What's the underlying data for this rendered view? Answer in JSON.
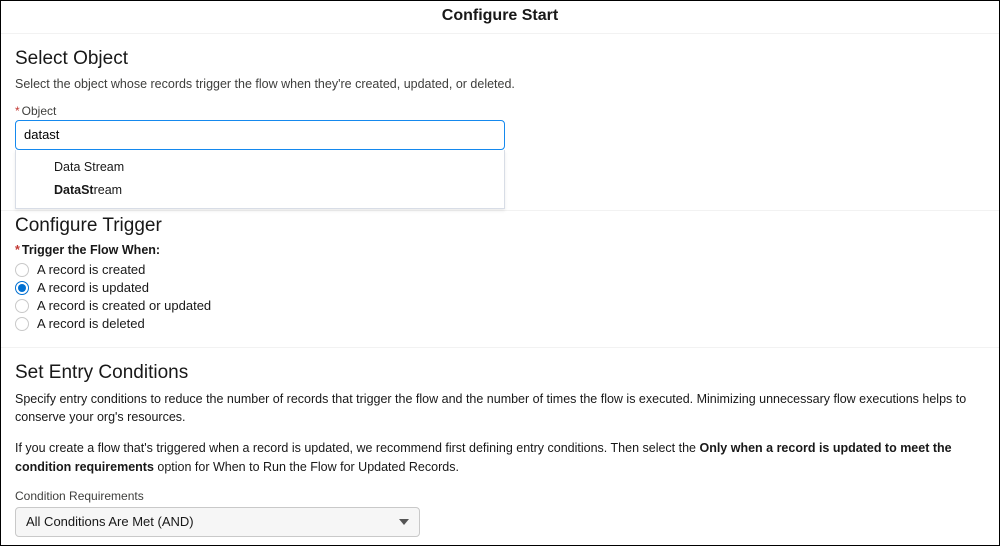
{
  "header": {
    "title": "Configure Start"
  },
  "selectObject": {
    "heading": "Select Object",
    "description": "Select the object whose records trigger the flow when they're created, updated, or deleted.",
    "field_label": "Object",
    "input_value": "datast",
    "options": [
      {
        "plain_prefix": "Data S",
        "plain_suffix": "tream",
        "matched": false
      },
      {
        "bold_prefix": "DataSt",
        "bold_suffix": "ream",
        "matched": true
      }
    ]
  },
  "configureTrigger": {
    "heading": "Configure Trigger",
    "group_label": "Trigger the Flow When:",
    "radios": [
      {
        "label": "A record is created",
        "selected": false
      },
      {
        "label": "A record is updated",
        "selected": true
      },
      {
        "label": "A record is created or updated",
        "selected": false
      },
      {
        "label": "A record is deleted",
        "selected": false
      }
    ]
  },
  "entryConditions": {
    "heading": "Set Entry Conditions",
    "para1": "Specify entry conditions to reduce the number of records that trigger the flow and the number of times the flow is executed. Minimizing unnecessary flow executions helps to conserve your org's resources.",
    "para2_lead": "If you create a flow that's triggered when a record is updated, we recommend first defining entry conditions. Then select the ",
    "para2_bold": "Only when a record is updated to meet the condition requirements",
    "para2_tail": " option for When to Run the Flow for Updated Records.",
    "requirements_label": "Condition Requirements",
    "requirements_value": "All Conditions Are Met (AND)"
  }
}
